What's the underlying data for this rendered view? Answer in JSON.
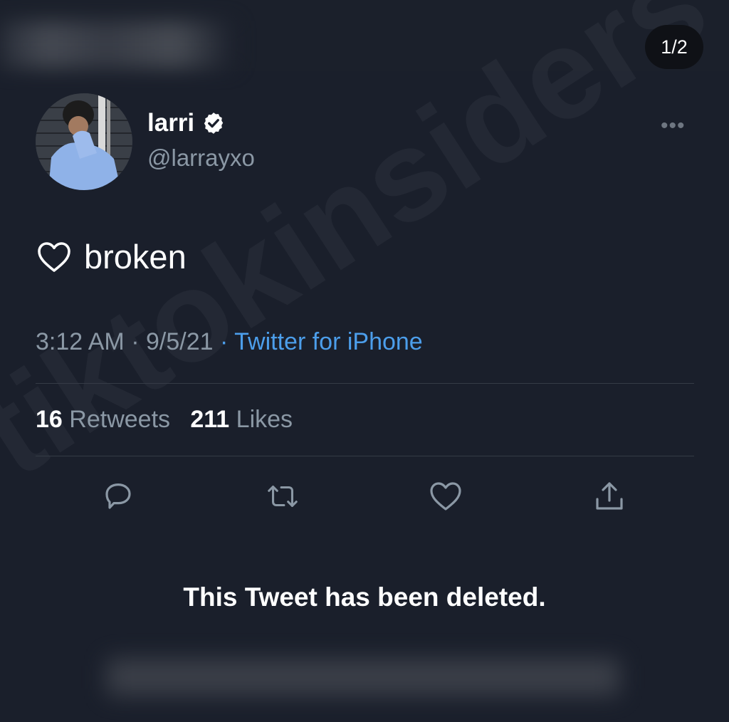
{
  "pager": {
    "label": "1/2"
  },
  "watermark": {
    "text": "tiktokinsiders"
  },
  "author": {
    "display_name": "larri",
    "handle": "@larrayxo",
    "verified_icon": "verified-badge-icon",
    "avatar_icon": "profile-photo"
  },
  "more_icon": "more-options-icon",
  "tweet": {
    "heart_icon": "outline-heart-icon",
    "text": "broken"
  },
  "meta": {
    "time": "3:12 AM",
    "sep1": "·",
    "date": "9/5/21",
    "sep2": "·",
    "source": "Twitter for iPhone"
  },
  "stats": {
    "retweets_count": "16",
    "retweets_label": "Retweets",
    "likes_count": "211",
    "likes_label": "Likes"
  },
  "actions": [
    {
      "icon": "reply-icon"
    },
    {
      "icon": "retweet-icon"
    },
    {
      "icon": "like-icon"
    },
    {
      "icon": "share-icon"
    }
  ],
  "notice": {
    "text": "This Tweet has been deleted."
  },
  "colors": {
    "background": "#1a1f2b",
    "link": "#4c9eeb",
    "muted": "#8b98a5",
    "text": "#ffffff"
  }
}
